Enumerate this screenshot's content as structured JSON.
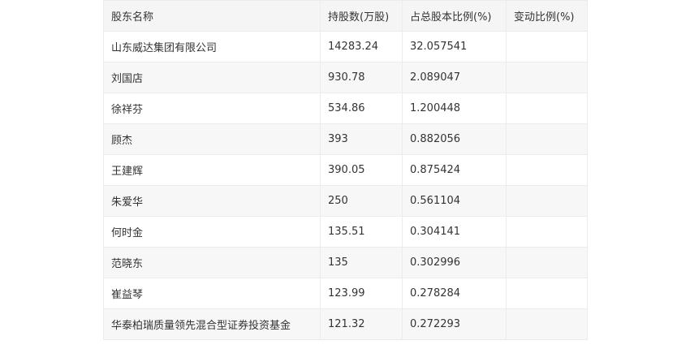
{
  "table": {
    "headers": [
      "股东名称",
      "持股数(万股)",
      "占总股本比例(%)",
      "变动比例(%)"
    ],
    "rows": [
      [
        "山东威达集团有限公司",
        "14283.24",
        "32.057541",
        ""
      ],
      [
        "刘国店",
        "930.78",
        "2.089047",
        ""
      ],
      [
        "徐祥芬",
        "534.86",
        "1.200448",
        ""
      ],
      [
        "顾杰",
        "393",
        "0.882056",
        ""
      ],
      [
        "王建辉",
        "390.05",
        "0.875424",
        ""
      ],
      [
        "朱爱华",
        "250",
        "0.561104",
        ""
      ],
      [
        "何时金",
        "135.51",
        "0.304141",
        ""
      ],
      [
        "范晓东",
        "135",
        "0.302996",
        ""
      ],
      [
        "崔益琴",
        "123.99",
        "0.278284",
        ""
      ],
      [
        "华泰柏瑞质量领先混合型证券投资基金",
        "121.32",
        "0.272293",
        ""
      ]
    ]
  }
}
